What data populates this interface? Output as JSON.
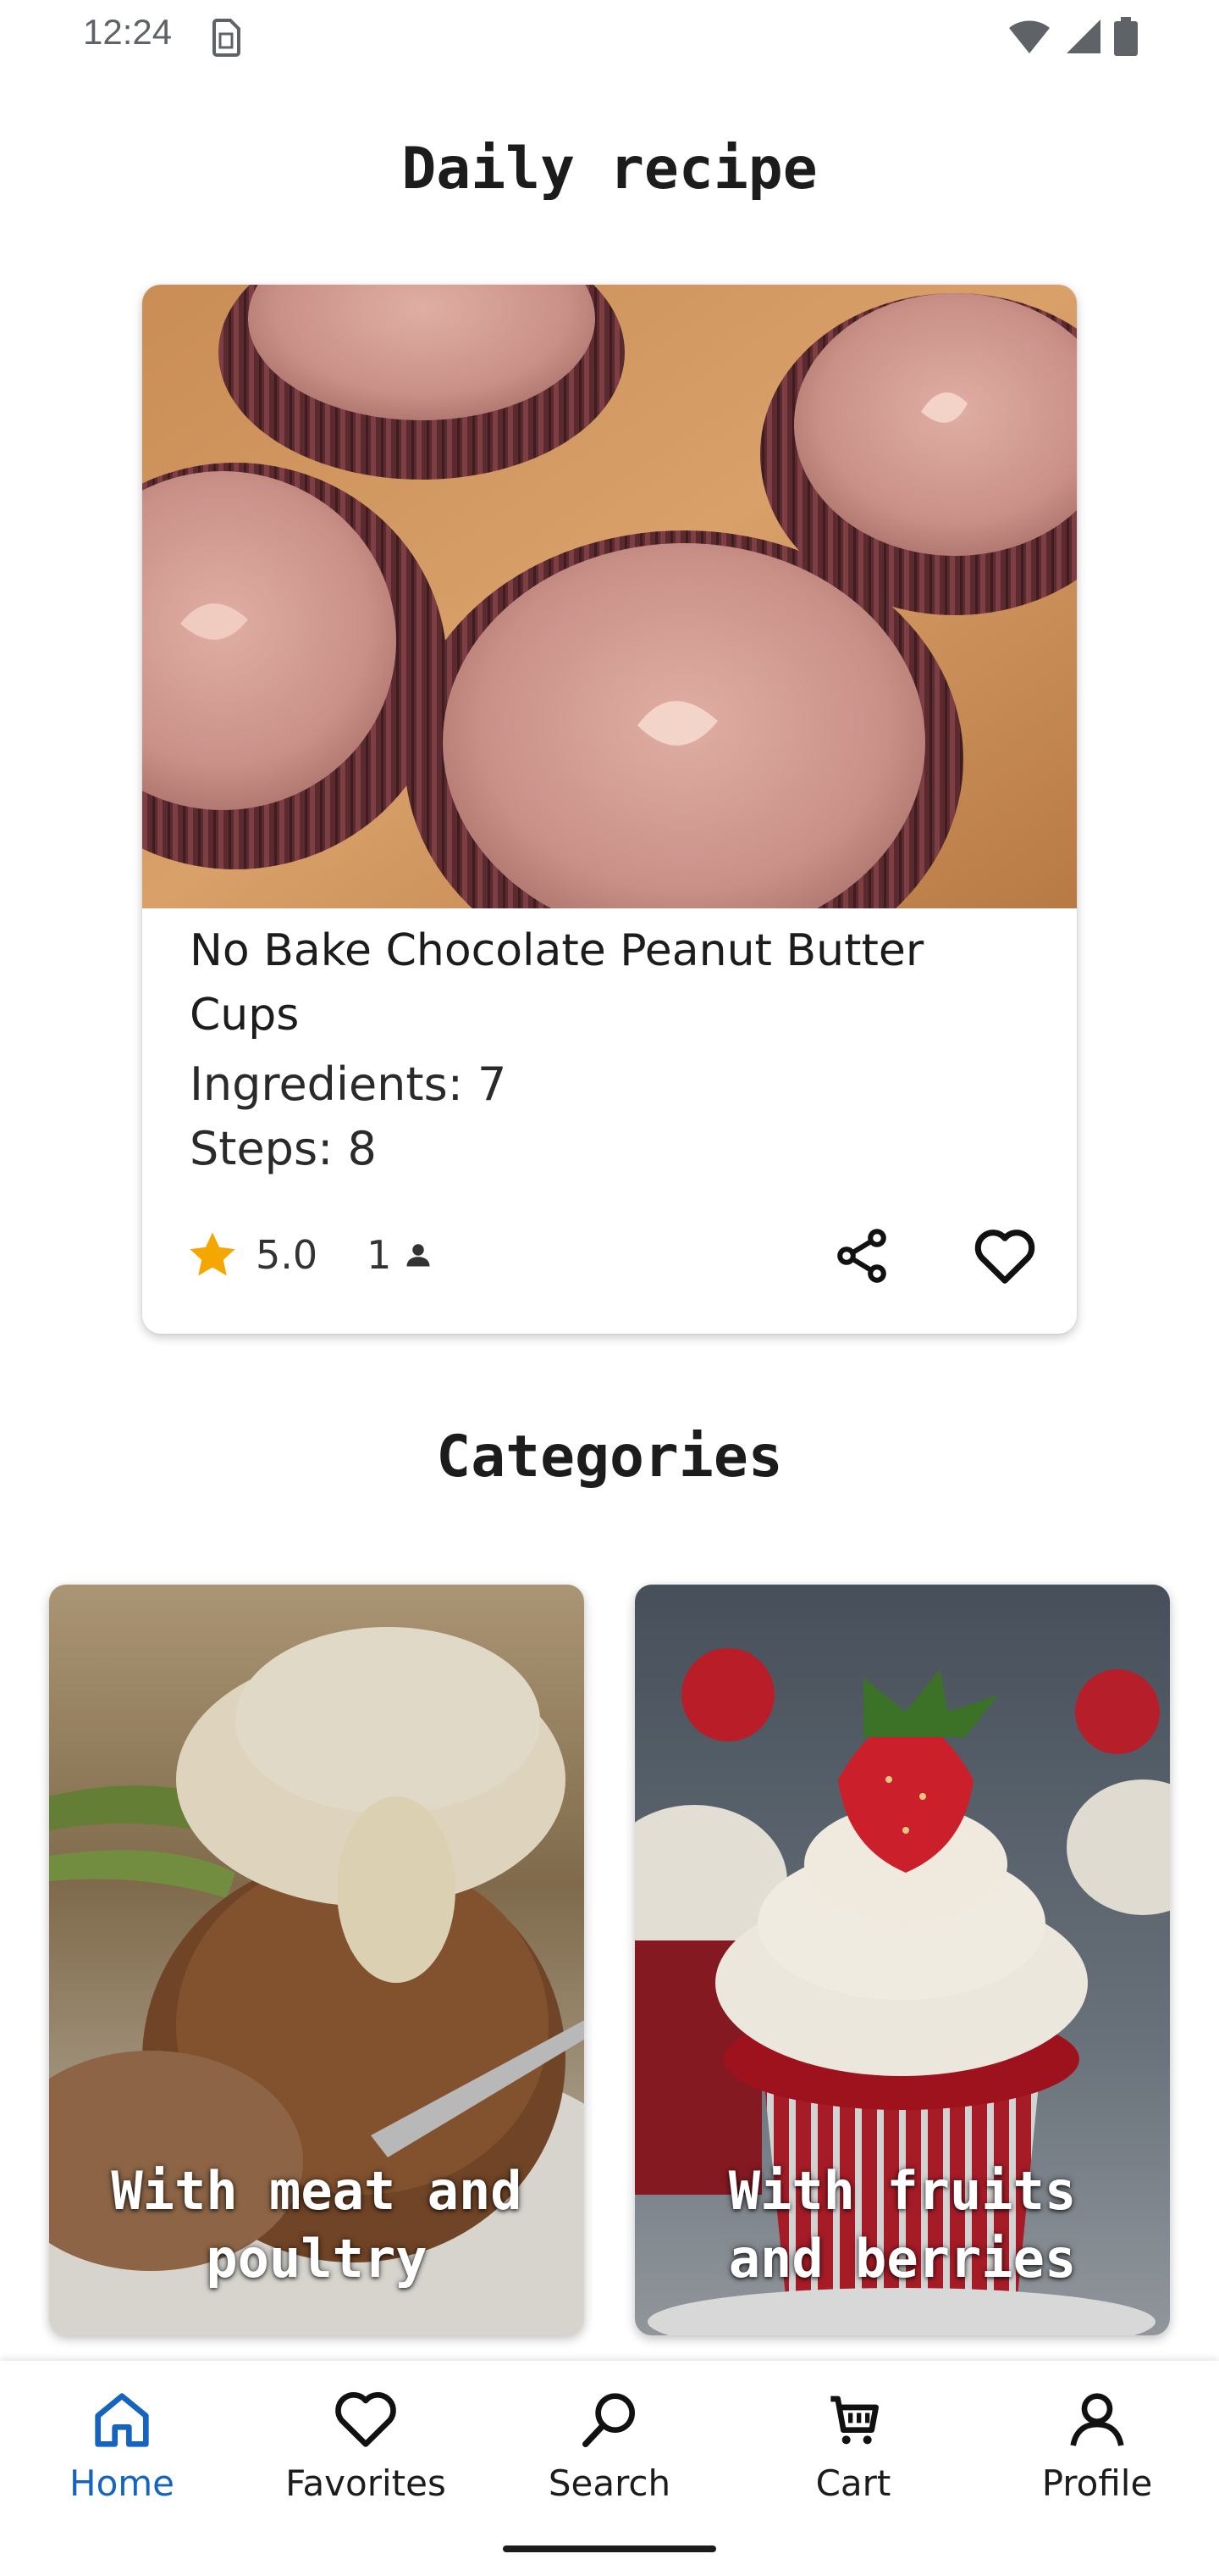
{
  "status_bar": {
    "time": "12:24"
  },
  "daily": {
    "title": "Daily recipe",
    "recipe_name": "No Bake Chocolate Peanut Butter Cups",
    "ingredients": "Ingredients: 7",
    "steps": "Steps: 8",
    "rating": "5.0",
    "reviews": "1",
    "star_color": "#f4a700"
  },
  "categories": {
    "title": "Categories",
    "items": [
      {
        "label": "With meat and poultry"
      },
      {
        "label": "With fruits and berries"
      }
    ]
  },
  "bottom_nav": {
    "active_color": "#1565c0",
    "items": [
      {
        "label": "Home",
        "icon": "home-icon",
        "active": true
      },
      {
        "label": "Favorites",
        "icon": "heart-icon",
        "active": false
      },
      {
        "label": "Search",
        "icon": "search-icon",
        "active": false
      },
      {
        "label": "Cart",
        "icon": "cart-icon",
        "active": false
      },
      {
        "label": "Profile",
        "icon": "person-icon",
        "active": false
      }
    ]
  }
}
